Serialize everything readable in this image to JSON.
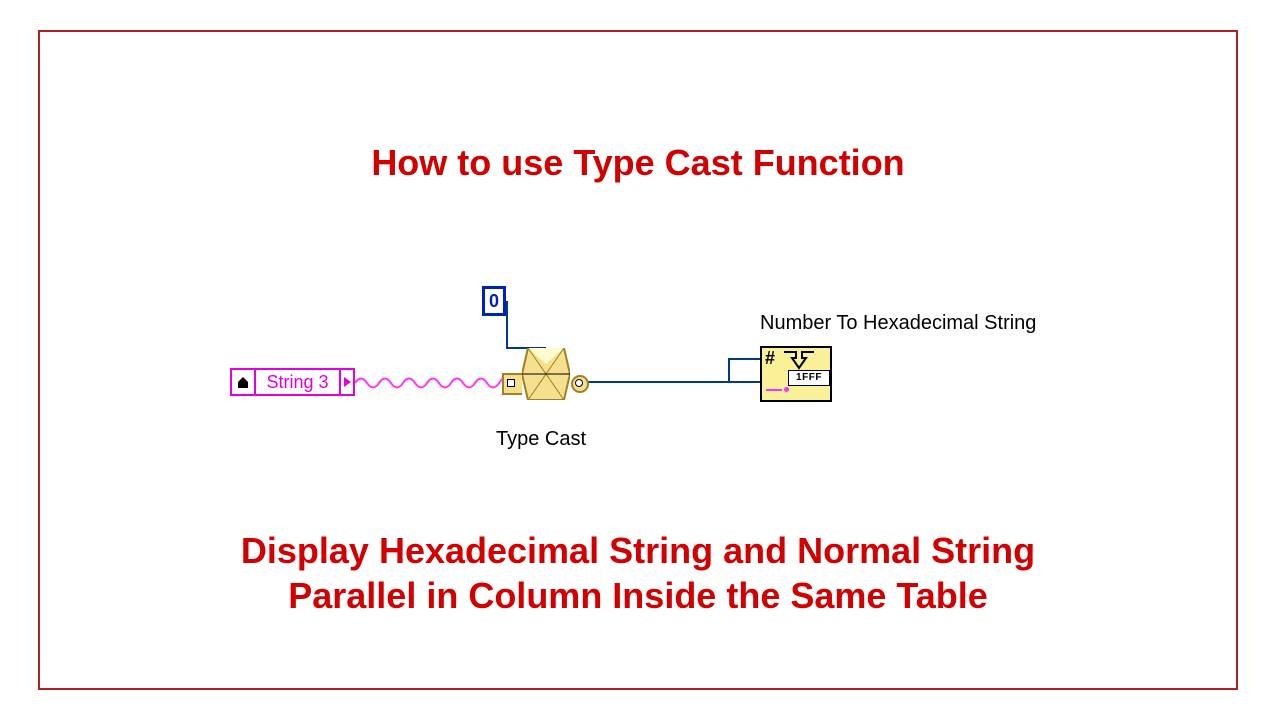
{
  "title": "How to use Type Cast  Function",
  "subtitle": "Display Hexadecimal String and Normal String\nParallel in Column Inside the Same Table",
  "diagram": {
    "string_control_label": "String 3",
    "zero_constant": "0",
    "typecast_label": "Type Cast",
    "hex_node_label": "Number To Hexadecimal String",
    "hex_node_hash": "#",
    "hex_node_value": "1FFF"
  },
  "colors": {
    "accent": "#d20000",
    "string_wire": "#ff30ff",
    "numeric_wire": "#003a8c",
    "node_fill": "#f9f098"
  }
}
